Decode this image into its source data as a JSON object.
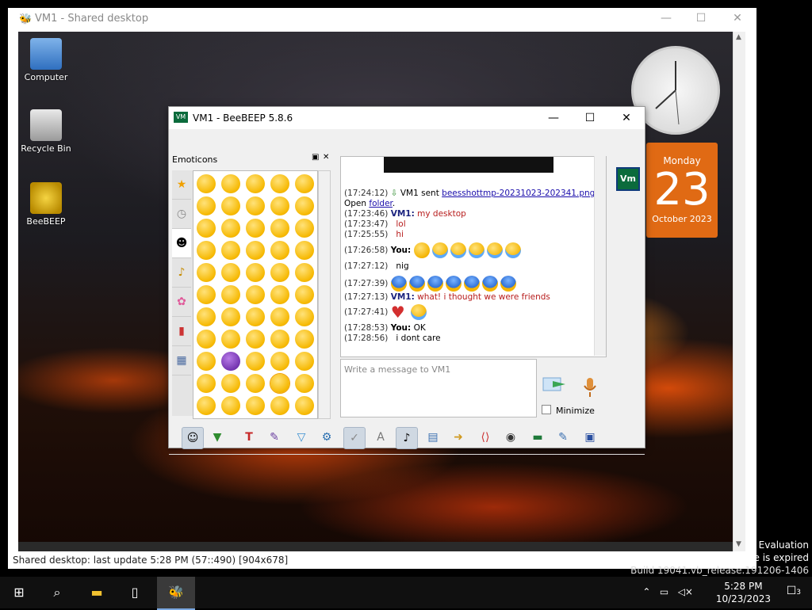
{
  "outer_window": {
    "title": "VM1 - Shared desktop",
    "minimize": "—",
    "maximize": "☐",
    "close": "✕",
    "status": "Shared desktop: last update 5:28 PM (57::490) [904x678]"
  },
  "desktop": {
    "icons": [
      {
        "label": "Computer"
      },
      {
        "label": "Recycle Bin"
      },
      {
        "label": "BeeBEEP"
      }
    ]
  },
  "calendar": {
    "day": "Monday",
    "date": "23",
    "month_year": "October 2023"
  },
  "beebeep": {
    "title": "VM1 - BeeBEEP 5.8.6",
    "emoticons_label": "Emoticons",
    "input_placeholder": "Write a message to VM1",
    "minimize_label": "Minimize",
    "vm_badge": "Vm",
    "chat": [
      {
        "ts": "(17:24:12)",
        "text": " VM1 sent ",
        "link": "beesshottmp-20231023-202341.png",
        "after": "."
      },
      {
        "prefix": "Open ",
        "link": "folder",
        "after": "."
      },
      {
        "ts": "(17:23:46)",
        "who": "VM1:",
        "text": "my desktop"
      },
      {
        "ts": "(17:23:47)",
        "text": "lol"
      },
      {
        "ts": "(17:25:55)",
        "text": "hi"
      },
      {
        "ts": "(17:26:58)",
        "who_me": "You:"
      },
      {
        "ts": "(17:27:12)",
        "text": "nig"
      },
      {
        "ts": "(17:27:39)"
      },
      {
        "ts": "(17:27:13)",
        "who": "VM1:",
        "text": "what! i thought we were friends"
      },
      {
        "ts": "(17:27:41)"
      },
      {
        "ts": "(17:28:53)",
        "who_me": "You:",
        "text": "OK"
      },
      {
        "ts": "(17:28:56)",
        "text": "i dont care"
      }
    ]
  },
  "watermark": {
    "line1": "e Evaluation",
    "line2": "se is expired",
    "line3": "Build 19041.vb_release.191206-1406"
  },
  "taskbar": {
    "time": "5:28 PM",
    "date": "10/23/2023",
    "notifications": "3"
  }
}
